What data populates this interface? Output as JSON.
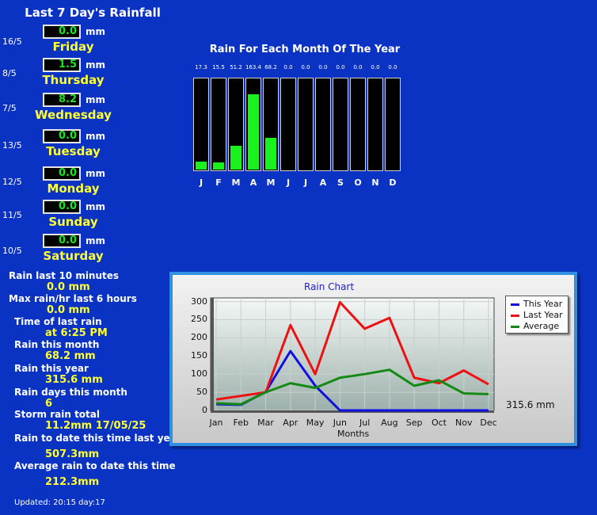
{
  "title": "Last 7 Day's Rainfall",
  "unit": "mm",
  "days": [
    {
      "date": "16/5",
      "value": "0.0",
      "name": "Friday"
    },
    {
      "date": "8/5",
      "value": "1.5",
      "name": "Thursday"
    },
    {
      "date": "7/5",
      "value": "8.2",
      "name": "Wednesday"
    },
    {
      "date": "13/5",
      "value": "0.0",
      "name": "Tuesday"
    },
    {
      "date": "12/5",
      "value": "0.0",
      "name": "Monday"
    },
    {
      "date": "11/5",
      "value": "0.0",
      "name": "Sunday"
    },
    {
      "date": "10/5",
      "value": "0.0",
      "name": "Saturday"
    }
  ],
  "stats": [
    {
      "label": "Rain last 10 minutes",
      "value": "0.0 mm"
    },
    {
      "label": "Max rain/hr last 6 hours",
      "value": "0.0 mm"
    },
    {
      "label": "Time of last rain",
      "value": "at 6:25 PM"
    },
    {
      "label": "Rain this month",
      "value": "68.2 mm"
    },
    {
      "label": "Rain this year",
      "value": "315.6 mm"
    },
    {
      "label": "Rain days this month",
      "value": "6"
    },
    {
      "label": "Storm rain total",
      "value": "11.2mm 17/05/25"
    },
    {
      "label": "Rain to date this time last year",
      "value": "507.3mm"
    },
    {
      "label": "Average rain to date this time",
      "value": "212.3mm"
    }
  ],
  "updated": "Updated: 20:15 day:17",
  "monthly": {
    "title": "Rain For Each Month Of The Year",
    "months": [
      "J",
      "F",
      "M",
      "A",
      "M",
      "J",
      "J",
      "A",
      "S",
      "O",
      "N",
      "D"
    ],
    "labels": [
      "17.3",
      "15.5",
      "51.2",
      "163.4",
      "68.2",
      "0.0",
      "0.0",
      "0.0",
      "0.0",
      "0.0",
      "0.0",
      "0.0"
    ],
    "values": [
      17.3,
      15.5,
      51.2,
      163.4,
      68.2,
      0,
      0,
      0,
      0,
      0,
      0,
      0
    ],
    "max": 200,
    "bar_color": "#19f21e"
  },
  "chart_data": {
    "type": "line",
    "title": "Rain Chart",
    "xlabel": "Months",
    "ylabel": "",
    "categories": [
      "Jan",
      "Feb",
      "Mar",
      "Apr",
      "May",
      "Jun",
      "Jul",
      "Aug",
      "Sep",
      "Oct",
      "Nov",
      "Dec"
    ],
    "yticks": [
      0,
      50,
      100,
      150,
      200,
      250,
      300
    ],
    "ylim": [
      0,
      310
    ],
    "series": [
      {
        "name": "This Year",
        "color": "#1010e0",
        "values": [
          17.3,
          15.5,
          51.2,
          163.4,
          68.2,
          0,
          0,
          0,
          0,
          0,
          0,
          0
        ]
      },
      {
        "name": "Last Year",
        "color": "#ee1111",
        "values": [
          30,
          40,
          50,
          235,
          100,
          298,
          225,
          255,
          90,
          75,
          110,
          72
        ]
      },
      {
        "name": "Average",
        "color": "#148a14",
        "values": [
          20,
          17,
          50,
          75,
          62,
          90,
          100,
          112,
          68,
          83,
          47,
          45
        ]
      }
    ],
    "total_label": "315.6 mm",
    "legend_position": "top-right",
    "grid": true
  }
}
